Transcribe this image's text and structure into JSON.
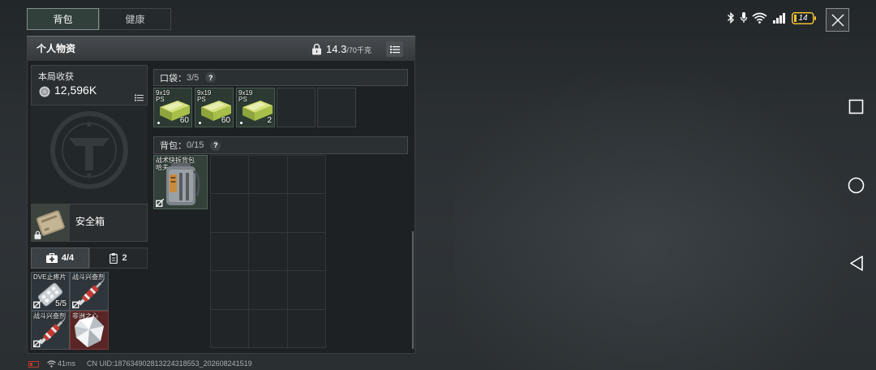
{
  "tabs": [
    {
      "label": "背包",
      "active": true
    },
    {
      "label": "健康",
      "active": false
    }
  ],
  "status_bar": {
    "icons": [
      "bluetooth-icon",
      "mic-icon",
      "wifi-icon",
      "signal-icon",
      "battery-icon"
    ],
    "battery_level": "14",
    "battery_color": "#f0c233"
  },
  "close_button": {
    "icon": "close-icon"
  },
  "system_nav": {
    "icons": [
      "recent-apps-icon",
      "home-icon",
      "back-icon"
    ]
  },
  "panel": {
    "title": "个人物资",
    "weight_current": "14.3",
    "weight_max": "/70千克",
    "weight_icon": "lock-icon",
    "menu_icon": "list-icon"
  },
  "earnings": {
    "label": "本局收获",
    "value": "12,596K",
    "icon": "coin-icon"
  },
  "safe_box": {
    "label": "安全箱",
    "icon": "safe-box-icon"
  },
  "safe_tabs": [
    {
      "label": "4/4",
      "icon": "medkit-icon",
      "active": true
    },
    {
      "label": "2",
      "icon": "clipboard-icon",
      "active": false
    }
  ],
  "safe_items": [
    {
      "name": "DVE止疼片",
      "count": "5/5",
      "icon": "painkiller-icon"
    },
    {
      "name": "战斗兴奋剂",
      "icon": "stimulant-syringe-icon"
    },
    {
      "name": "战斗兴奋剂",
      "icon": "stimulant-syringe-icon"
    },
    {
      "name": "非洲之心",
      "icon": "diamond-icon",
      "rarity_color": "#5a2525"
    }
  ],
  "pocket": {
    "label": "口袋：",
    "count": "3/5",
    "help": "?",
    "items": [
      {
        "caliber": "9x19",
        "type": "PS",
        "count": "60",
        "icon": "ammo-box-icon"
      },
      {
        "caliber": "9x19",
        "type": "PS",
        "count": "60",
        "icon": "ammo-box-icon"
      },
      {
        "caliber": "9x19",
        "type": "PS",
        "count": "2",
        "icon": "ammo-box-icon"
      }
    ]
  },
  "backpack": {
    "label": "背包：",
    "count": "0/15",
    "help": "?",
    "item": {
      "name": "战术快拆背包",
      "brand": "哈夫",
      "icon": "backpack-icon"
    }
  },
  "footer": {
    "ping": "41ms",
    "uid": "CN UID:187634902813224318553_202608241519"
  }
}
